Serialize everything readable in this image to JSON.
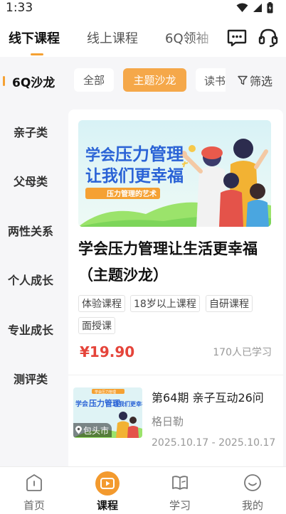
{
  "status_bar": {
    "time": "1:33"
  },
  "top_tabs": [
    {
      "label": "线下课程",
      "active": true
    },
    {
      "label": "线上课程",
      "active": false
    },
    {
      "label": "6Q领袖",
      "active": false
    }
  ],
  "filter": {
    "category_title": "6Q沙龙",
    "chips": [
      {
        "label": "全部",
        "active": false
      },
      {
        "label": "主题沙龙",
        "active": true
      },
      {
        "label": "读书",
        "active": false
      }
    ],
    "filter_label": "筛选"
  },
  "sidebar": {
    "items": [
      "亲子类",
      "父母类",
      "两性关系",
      "个人成长",
      "专业成长",
      "测评类"
    ]
  },
  "course": {
    "banner_line1_a": "学会",
    "banner_line1_b": "压力管理",
    "banner_line2": "让我们更幸福",
    "banner_tag": "压力管理的艺术",
    "title": "学会压力管理让生活更幸福（主题沙龙）",
    "tags": [
      "体验课程",
      "18岁以上课程",
      "自研课程",
      "面授课"
    ],
    "price": "¥19.90",
    "learners": "170人已学习"
  },
  "course2": {
    "thumb_top": "学会压力管理",
    "thumb_text_a": "学会",
    "thumb_text_b": "压力管理",
    "thumb_text_c": "让我们更幸福",
    "location": "包头市",
    "title": "第64期  亲子互动26问",
    "subtitle": "格日勒",
    "date": "2025.10.17 - 2025.10.17"
  },
  "bottom_nav": [
    {
      "label": "首页",
      "icon": "home-icon",
      "active": false
    },
    {
      "label": "课程",
      "icon": "play-icon",
      "active": true
    },
    {
      "label": "学习",
      "icon": "book-icon",
      "active": false
    },
    {
      "label": "我的",
      "icon": "smile-icon",
      "active": false
    }
  ],
  "colors": {
    "accent": "#f5a133",
    "price": "#e5443a",
    "banner_green": "#9be36b"
  }
}
